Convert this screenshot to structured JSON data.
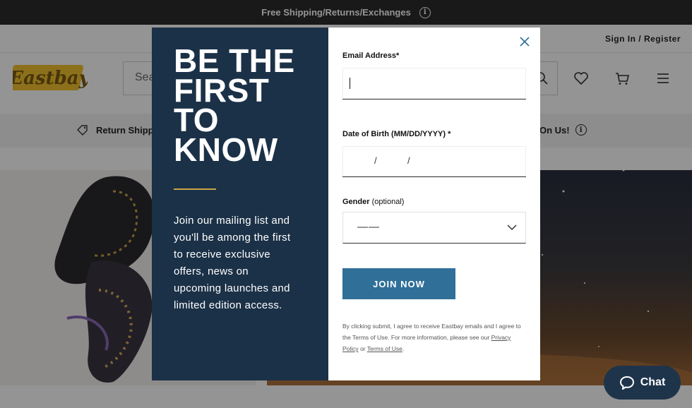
{
  "promo_bar": {
    "text": "Free Shipping/Returns/Exchanges",
    "info_icon": "i"
  },
  "util_bar": {
    "sign_in": "Sign In",
    "separator": "/",
    "register": "Register"
  },
  "header": {
    "logo_text": "Eastbay",
    "search_placeholder": "Sea",
    "icons": [
      "search-icon",
      "heart-icon",
      "cart-icon",
      "menu-icon"
    ]
  },
  "strip": {
    "left_text": "Return Shipp",
    "right_text": "On Us!",
    "info_icon": "i"
  },
  "modal": {
    "headline": "BE THE FIRST TO KNOW",
    "blurb": "Join our mailing list and you'll be among the first to receive exclusive offers, news on upcoming launches and limited edition access.",
    "email_label": "Email Address*",
    "email_value": "",
    "dob_label": "Date of Birth (MM/DD/YYYY) *",
    "dob_sep_1": "/",
    "dob_sep_2": "/",
    "gender_label": "Gender",
    "gender_optional": "(optional)",
    "gender_value": "——",
    "join_label": "JOIN NOW",
    "legal_text": "By clicking submit, I agree to receive Eastbay emails and I agree to the Terms of Use. For more information, please see our",
    "privacy_link": "Privacy Policy",
    "legal_or": "or",
    "terms_link": "Terms of Use",
    "legal_end": ".",
    "colors": {
      "panel": "#1b3147",
      "accent": "#c9a24a",
      "button": "#2f6f98"
    }
  },
  "chat": {
    "label": "Chat"
  }
}
